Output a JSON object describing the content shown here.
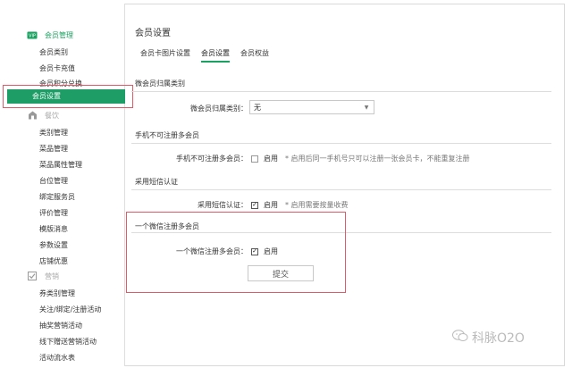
{
  "sidebar": {
    "sections": [
      {
        "title": "会员管理",
        "icon": "vip-icon",
        "state": "active",
        "items": [
          "会员类别",
          "会员卡充值",
          "会员积分兑换",
          "会员设置"
        ],
        "selected_index": 3
      },
      {
        "title": "餐饮",
        "icon": "shop-icon",
        "state": "muted",
        "items": [
          "类别管理",
          "菜品管理",
          "菜品属性管理",
          "台位管理",
          "绑定服务员",
          "评价管理",
          "模版消息",
          "参数设置",
          "店铺优惠"
        ]
      },
      {
        "title": "营销",
        "icon": "checkbox-icon",
        "state": "muted",
        "items": [
          "券类别管理",
          "关注/绑定/注册活动",
          "抽奖营销活动",
          "线下赠送营销活动",
          "活动流水表"
        ]
      }
    ]
  },
  "main": {
    "title": "会员设置",
    "tabs": [
      {
        "label": "会员卡图片设置",
        "active": false
      },
      {
        "label": "会员设置",
        "active": true
      },
      {
        "label": "会员权益",
        "active": false
      }
    ],
    "groups": {
      "wechat_category": {
        "title": "微会员归属类别",
        "label": "微会员归属类别：",
        "value": "无"
      },
      "phone_multi": {
        "title": "手机不可注册多会员",
        "label": "手机不可注册多会员：",
        "checked": false,
        "option": "启用",
        "hint": "* 启用后同一手机号只可以注册一张会员卡，不能重复注册"
      },
      "sms_verify": {
        "title": "采用短信认证",
        "label": "采用短信认证：",
        "checked": true,
        "option": "启用",
        "hint": "* 启用需要按量收费"
      },
      "wechat_multi": {
        "title": "一个微信注册多会员",
        "label": "一个微信注册多会员：",
        "checked": true,
        "option": "启用"
      }
    },
    "submit_label": "提交"
  },
  "watermark": {
    "text": "科脉O2O"
  }
}
